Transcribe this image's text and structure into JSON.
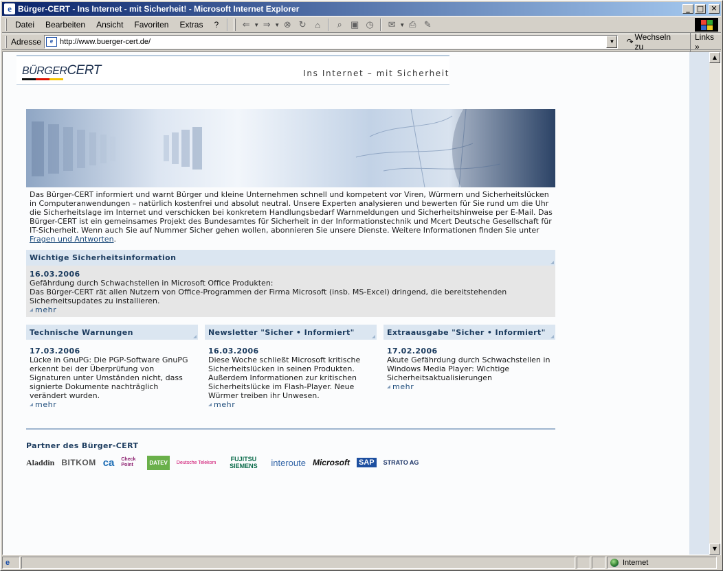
{
  "window": {
    "title": "Bürger-CERT - Ins Internet - mit Sicherheit! - Microsoft Internet Explorer",
    "btn_min": "_",
    "btn_max": "□",
    "btn_close": "✕"
  },
  "menu": {
    "items": [
      "Datei",
      "Bearbeiten",
      "Ansicht",
      "Favoriten",
      "Extras",
      "?"
    ]
  },
  "toolbar": {
    "icons": [
      "back-icon",
      "forward-icon",
      "stop-icon",
      "refresh-icon",
      "home-icon",
      "search-icon",
      "favorites-icon",
      "history-icon",
      "mail-icon",
      "print-icon",
      "edit-icon"
    ]
  },
  "address": {
    "label": "Adresse",
    "url": "http://www.buerger-cert.de/",
    "go_label": "Wechseln zu",
    "links_label": "Links"
  },
  "site": {
    "logo_text_1": "BÜRGER",
    "logo_text_2": "CERT",
    "tagline": "Ins Internet – mit Sicherheit",
    "intro": "Das Bürger-CERT informiert und warnt Bürger und kleine Unternehmen schnell und kompetent vor Viren, Würmern und Sicherheitslücken in Computeranwendungen – natürlich kostenfrei und absolut neutral. Unsere Experten analysieren und bewerten für Sie rund um die Uhr die Sicherheitslage im Internet und verschicken bei konkretem Handlungsbedarf Warnmeldungen und Sicherheitshinweise per E-Mail. Das Bürger-CERT ist ein gemeinsames Projekt des Bundesamtes für Sicherheit in der Informationstechnik und Mcert Deutsche Gesellschaft für IT-Sicherheit. Wenn auch Sie auf Nummer Sicher gehen wollen, abonnieren Sie unsere Dienste. Weitere Informationen finden Sie unter",
    "intro_link": "Fragen und Antworten",
    "intro_end": ".",
    "security": {
      "heading": "Wichtige Sicherheitsinformation",
      "date": "16.03.2006",
      "title": "Gefährdung durch Schwachstellen in Microsoft Office Produkten:",
      "text": "Das Bürger-CERT rät allen Nutzern von Office-Programmen der Firma Microsoft (insb. MS-Excel) dringend, die bereitstehenden Sicherheitsupdates zu installieren.",
      "more": "mehr"
    },
    "columns": [
      {
        "heading": "Technische Warnungen",
        "date": "17.03.2006",
        "text": "Lücke in GnuPG: Die PGP-Software GnuPG erkennt bei der Überprüfung von Signaturen unter Umständen nicht, dass signierte Dokumente nachträglich verändert wurden.",
        "more": "mehr"
      },
      {
        "heading": "Newsletter \"Sicher • Informiert\"",
        "date": "16.03.2006",
        "text": "Diese Woche schließt Microsoft kritische Sicherheitslücken in seinen Produkten. Außerdem Informationen zur kritischen Sicherheitslücke im Flash-Player. Neue Würmer treiben ihr Unwesen.",
        "more": "mehr"
      },
      {
        "heading": "Extraausgabe \"Sicher • Informiert\"",
        "date": "17.02.2006",
        "text": "Akute Gefährdung durch Schwachstellen in Windows Media Player: Wichtige Sicherheitsaktualisierungen",
        "more": "mehr"
      }
    ],
    "partners_heading": "Partner des Bürger-CERT",
    "partners": [
      "Aladdin",
      "BITKOM",
      "ca",
      "Check Point",
      "DATEV",
      "Deutsche Telekom",
      "FUJITSU SIEMENS",
      "interoute",
      "Microsoft",
      "SAP",
      "STRATO AG"
    ]
  },
  "status": {
    "zone": "Internet"
  },
  "colors": {
    "brand_dark": "#1b3b5e",
    "box_head": "#dbe6f1",
    "title_bar": "#0a246a"
  }
}
